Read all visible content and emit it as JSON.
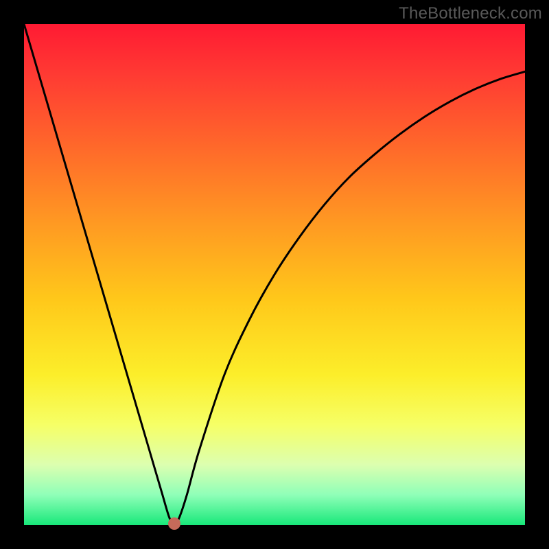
{
  "watermark": "TheBottleneck.com",
  "chart_data": {
    "type": "line",
    "title": "",
    "xlabel": "",
    "ylabel": "",
    "xlim": [
      0,
      1
    ],
    "ylim": [
      0,
      1
    ],
    "legend": false,
    "grid": false,
    "series": [
      {
        "name": "bottleneck-curve",
        "x": [
          0.0,
          0.05,
          0.1,
          0.15,
          0.2,
          0.225,
          0.25,
          0.275,
          0.29,
          0.3,
          0.31,
          0.325,
          0.35,
          0.4,
          0.45,
          0.5,
          0.55,
          0.6,
          0.65,
          0.7,
          0.75,
          0.8,
          0.85,
          0.9,
          0.95,
          1.0
        ],
        "values": [
          1.0,
          0.83,
          0.66,
          0.49,
          0.32,
          0.235,
          0.15,
          0.065,
          0.015,
          0.0,
          0.015,
          0.06,
          0.15,
          0.3,
          0.41,
          0.5,
          0.575,
          0.64,
          0.695,
          0.74,
          0.78,
          0.815,
          0.845,
          0.87,
          0.89,
          0.905
        ]
      }
    ],
    "annotations": [
      {
        "name": "min-point-dot",
        "x": 0.3,
        "y": 0.003
      }
    ],
    "background": "rainbow-vertical-gradient",
    "colors": {
      "curve": "#000000",
      "dot": "#c56a5a",
      "gradient_top": "#ff1a33",
      "gradient_bottom": "#18e87a"
    }
  }
}
